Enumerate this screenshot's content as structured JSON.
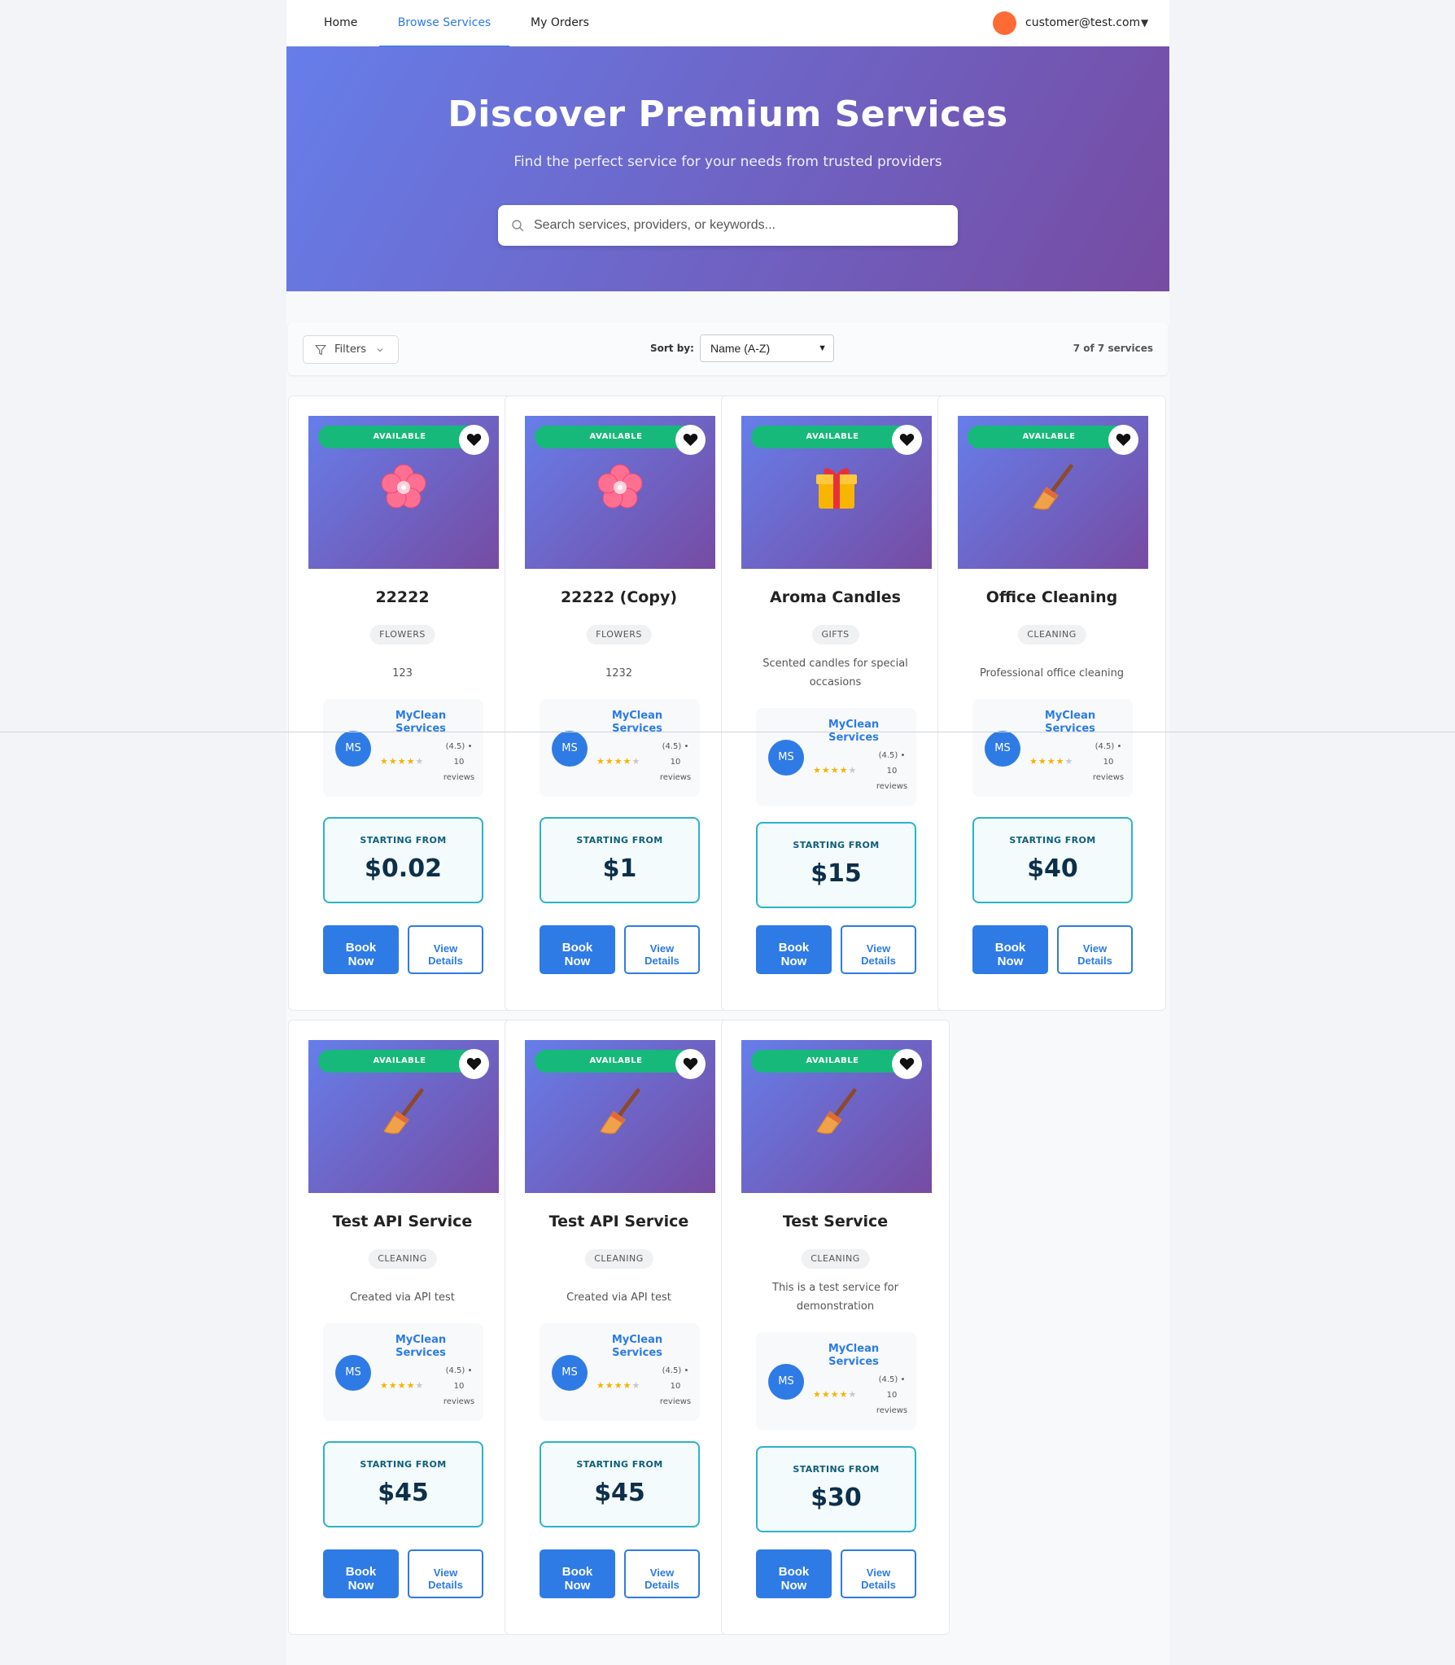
{
  "nav": {
    "links": [
      "Home",
      "Browse Services",
      "My Orders"
    ],
    "user_email": "customer@test.com",
    "caret": "▼"
  },
  "hero": {
    "title": "Discover Premium Services",
    "subtitle": "Find the perfect service for your needs from trusted providers",
    "search_placeholder": "Search services, providers, or keywords...",
    "search_value": ""
  },
  "toolbar": {
    "filters_label": "Filters",
    "sort_label": "Sort by:",
    "sort_value": "Name (A-Z)",
    "count_text": "7 of 7 services"
  },
  "card_labels": {
    "badge": "AVAILABLE",
    "price_label": "STARTING FROM",
    "book": [
      "Book",
      "Now"
    ],
    "view": [
      "View",
      "Details"
    ]
  },
  "services": [
    {
      "title": "22222",
      "category": "FLOWERS",
      "description": [
        "123"
      ],
      "icon": "cherry-blossom-icon",
      "provider": {
        "initials": "MS",
        "name": [
          "MyClean",
          "Services"
        ],
        "rating": [
          "(4.5) •",
          "10",
          "reviews"
        ],
        "stars": 4
      },
      "price": "$0.02"
    },
    {
      "title": "22222 (Copy)",
      "category": "FLOWERS",
      "description": [
        "1232"
      ],
      "icon": "cherry-blossom-icon",
      "provider": {
        "initials": "MS",
        "name": [
          "MyClean",
          "Services"
        ],
        "rating": [
          "(4.5) •",
          "10",
          "reviews"
        ],
        "stars": 4
      },
      "price": "$1"
    },
    {
      "title": "Aroma Candles",
      "category": "GIFTS",
      "description": [
        "Scented candles for special",
        "occasions"
      ],
      "icon": "gift-icon",
      "provider": {
        "initials": "MS",
        "name": [
          "MyClean",
          "Services"
        ],
        "rating": [
          "(4.5) •",
          "10",
          "reviews"
        ],
        "stars": 4
      },
      "price": "$15"
    },
    {
      "title": "Office Cleaning",
      "category": "CLEANING",
      "description": [
        "Professional office cleaning"
      ],
      "icon": "broom-icon",
      "provider": {
        "initials": "MS",
        "name": [
          "MyClean",
          "Services"
        ],
        "rating": [
          "(4.5) •",
          "10",
          "reviews"
        ],
        "stars": 4
      },
      "price": "$40"
    },
    {
      "title": "Test API Service",
      "category": "CLEANING",
      "description": [
        "Created via API test"
      ],
      "icon": "broom-icon",
      "provider": {
        "initials": "MS",
        "name": [
          "MyClean",
          "Services"
        ],
        "rating": [
          "(4.5) •",
          "10",
          "reviews"
        ],
        "stars": 4
      },
      "price": "$45"
    },
    {
      "title": "Test API Service",
      "category": "CLEANING",
      "description": [
        "Created via API test"
      ],
      "icon": "broom-icon",
      "provider": {
        "initials": "MS",
        "name": [
          "MyClean",
          "Services"
        ],
        "rating": [
          "(4.5) •",
          "10",
          "reviews"
        ],
        "stars": 4
      },
      "price": "$45"
    },
    {
      "title": "Test Service",
      "category": "CLEANING",
      "description": [
        "This is a test service for",
        "demonstration"
      ],
      "icon": "broom-icon",
      "provider": {
        "initials": "MS",
        "name": [
          "MyClean",
          "Services"
        ],
        "rating": [
          "(4.5) •",
          "10",
          "reviews"
        ],
        "stars": 4
      },
      "price": "$30"
    }
  ],
  "colors": {
    "accent": "#2f7be6",
    "available": "#16b97a",
    "hero_start": "#667eea",
    "hero_end": "#764ba2",
    "user_dot": "#ff6b35"
  }
}
